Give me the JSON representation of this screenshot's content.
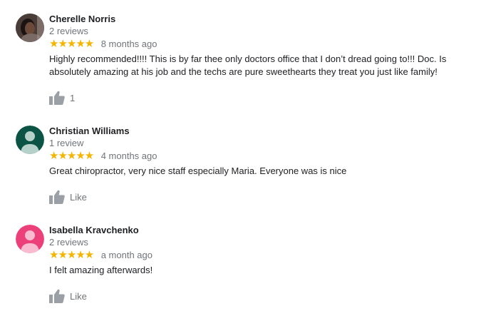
{
  "reviews": [
    {
      "name": "Cherelle Norris",
      "review_count": "2 reviews",
      "stars": "★★★★★",
      "date": "8 months ago",
      "text": "Highly recommended!!!! This is by far thee only doctors office that I don’t dread going to!!! Doc. Is absolutely amazing at his job and the techs are pure sweethearts they treat you just like family!",
      "like_label": "1",
      "avatar": {
        "type": "photo",
        "bg": "#3a2f2c"
      }
    },
    {
      "name": "Christian Williams",
      "review_count": "1 review",
      "stars": "★★★★★",
      "date": "4 months ago",
      "text": "Great chiropractor, very nice staff especially Maria. Everyone was is nice",
      "like_label": "Like",
      "avatar": {
        "type": "default",
        "bg": "#0b5345",
        "fg": "#b6d1c9"
      }
    },
    {
      "name": "Isabella Kravchenko",
      "review_count": "2 reviews",
      "stars": "★★★★★",
      "date": "a month ago",
      "text": "I felt amazing afterwards!",
      "like_label": "Like",
      "avatar": {
        "type": "default",
        "bg": "#ec407a",
        "fg": "#f8bbd0"
      }
    }
  ],
  "colors": {
    "star": "#f4b400",
    "muted": "#70757a",
    "thumb": "#9aa0a6"
  },
  "icons": {
    "like": "thumbs-up-icon",
    "avatar_default": "person-icon"
  }
}
